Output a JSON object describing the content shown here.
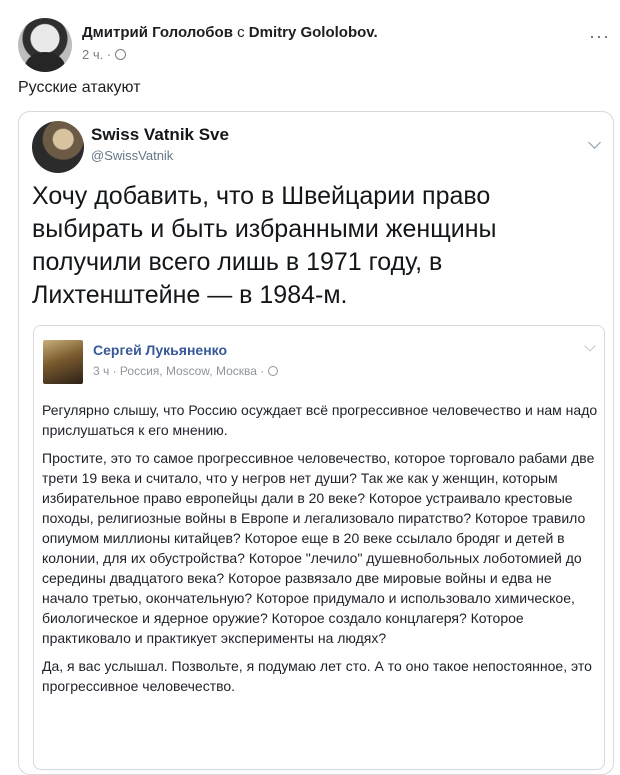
{
  "post": {
    "author": "Дмитрий Гололобов",
    "with_text": "с",
    "with_name": "Dmitry Gololobov.",
    "time": "2 ч. ·",
    "menu": "···",
    "text": "Русские атакуют"
  },
  "tweet": {
    "name": "Swiss Vatnik Sve",
    "handle": "@SwissVatnik",
    "text": "Хочу добавить, что в Швейцарии право выбирать и быть избранными женщины получили всего лишь в 1971 году, в Лихтенштейне — в 1984-м."
  },
  "quoted_post": {
    "author": "Сергей Лукьяненко",
    "meta": "3 ч · Россия, Moscow, Москва ·",
    "paragraphs": [
      "Регулярно слышу, что Россию осуждает всё прогрессивное человечество и нам надо прислушаться к его мнению.",
      "Простите, это то самое прогрессивное человечество, которое торговало рабами две трети 19 века и считало, что у негров нет души? Так же как у женщин, которым избирательное право европейцы дали в 20 веке? Которое устраивало крестовые походы, религиозные войны в Европе и легализовало пиратство? Которое травило опиумом миллионы китайцев? Которое еще в 20 веке ссылало бродяг и детей в колонии, для их обустройства? Которое \"лечило\" душевнобольных лоботомией до середины двадцатого века? Которое развязало две мировые войны и едва не начало третью, окончательную? Которое придумало и использовало химическое, биологическое и ядерное оружие? Которое создало концлагеря? Которое практиковало и практикует эксперименты на людях?",
      "Да, я вас услышал. Позвольте, я подумаю лет сто. А то оно такое непостоянное, это прогрессивное человечество."
    ]
  }
}
